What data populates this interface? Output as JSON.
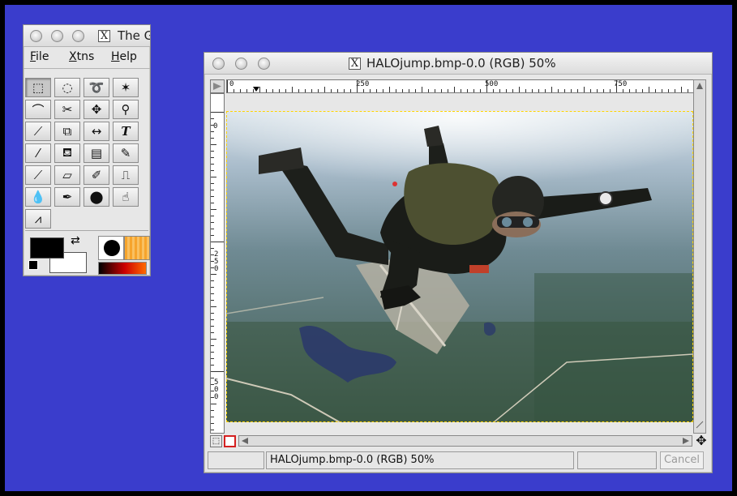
{
  "toolbox": {
    "title": "The G",
    "menu": [
      {
        "label": "File"
      },
      {
        "label": "Xtns"
      },
      {
        "label": "Help"
      }
    ],
    "tools": [
      {
        "name": "rect-select",
        "glyph": "⬚"
      },
      {
        "name": "ellipse-select",
        "glyph": "◌"
      },
      {
        "name": "lasso-select",
        "glyph": "➰"
      },
      {
        "name": "fuzzy-select",
        "glyph": "✶"
      },
      {
        "name": "bezier-select",
        "glyph": "⌒"
      },
      {
        "name": "scissors-select",
        "glyph": "✂"
      },
      {
        "name": "move",
        "glyph": "✥"
      },
      {
        "name": "magnify",
        "glyph": "⚲"
      },
      {
        "name": "crop",
        "glyph": "⟋"
      },
      {
        "name": "transform",
        "glyph": "⧉"
      },
      {
        "name": "flip",
        "glyph": "↔"
      },
      {
        "name": "text",
        "glyph": "T"
      },
      {
        "name": "color-picker",
        "glyph": "⁄"
      },
      {
        "name": "bucket-fill",
        "glyph": "⛾"
      },
      {
        "name": "blend",
        "glyph": "▤"
      },
      {
        "name": "pencil",
        "glyph": "✎"
      },
      {
        "name": "paintbrush",
        "glyph": "⟋"
      },
      {
        "name": "eraser",
        "glyph": "▱"
      },
      {
        "name": "airbrush",
        "glyph": "✐"
      },
      {
        "name": "clone",
        "glyph": "⎍"
      },
      {
        "name": "convolve",
        "glyph": "💧"
      },
      {
        "name": "ink",
        "glyph": "✒"
      },
      {
        "name": "dodge-burn",
        "glyph": "⬤"
      },
      {
        "name": "smudge",
        "glyph": "☝"
      },
      {
        "name": "measure",
        "glyph": "⩘"
      }
    ],
    "fg_color": "#000000",
    "bg_color": "#ffffff"
  },
  "image_window": {
    "title": "HALOjump.bmp-0.0 (RGB) 50%",
    "ruler_h_labels": [
      "0",
      "250",
      "500",
      "750"
    ],
    "ruler_v_labels": [
      "0",
      "250",
      "500"
    ],
    "status_text": "HALOjump.bmp-0.0 (RGB) 50%",
    "cancel_label": "Cancel"
  }
}
